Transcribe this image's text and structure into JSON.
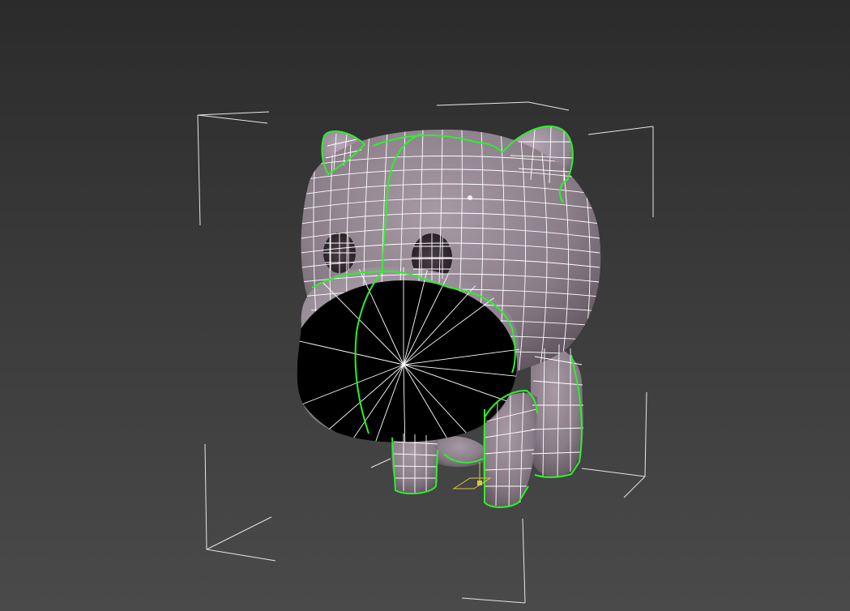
{
  "viewport": {
    "background_top": "#2b2b2b",
    "background_bottom": "#4a4a4a"
  },
  "model": {
    "mesh_color": "#8a7d88",
    "wireframe_color": "#ffffff",
    "seam_color": "#2cf02c",
    "bounding_box_color": "#e6e6e6",
    "pivot_color": "#d9c840"
  }
}
